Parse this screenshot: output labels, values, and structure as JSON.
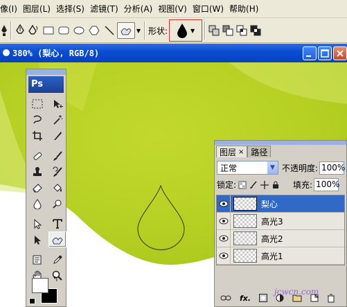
{
  "menu": {
    "items": [
      "像(I)",
      "图层(L)",
      "选择(S)",
      "滤镜(T)",
      "分析(A)",
      "视图(V)",
      "窗口(W)",
      "帮助(H)"
    ]
  },
  "options_bar": {
    "shape_label": "形状:",
    "tools": [
      "pen-icon",
      "freeform-pen-icon",
      "rectangle-icon",
      "rounded-rectangle-icon",
      "ellipse-icon",
      "polygon-icon",
      "line-icon",
      "custom-shape-icon"
    ],
    "shape_selected": "raindrop-shape",
    "combine_modes": [
      "add-icon",
      "subtract-icon",
      "intersect-icon",
      "exclude-icon"
    ]
  },
  "document": {
    "title": "380% (梨心, RGB/8)"
  },
  "toolbox": {
    "logo": "Ps",
    "tools": [
      "marquee-icon",
      "move-icon",
      "lasso-icon",
      "magic-wand-icon",
      "crop-icon",
      "slice-icon",
      "healing-brush-icon",
      "brush-icon",
      "clone-stamp-icon",
      "history-brush-icon",
      "eraser-icon",
      "paint-bucket-icon",
      "blur-icon",
      "dodge-icon",
      "path-selection-icon",
      "type-icon",
      "direct-selection-icon",
      "custom-shape-icon",
      "notes-icon",
      "eyedropper-icon",
      "hand-icon",
      "zoom-icon"
    ],
    "selected_tool": "custom-shape-icon",
    "foreground_color": "#ffffff",
    "background_color": "#000000"
  },
  "layers_panel": {
    "tabs": [
      "图层",
      "路径"
    ],
    "blend_mode": "正常",
    "opacity_label": "不透明度:",
    "opacity": "100%",
    "lock_label": "锁定:",
    "fill_label": "填充:",
    "fill": "100%",
    "layers": [
      {
        "name": "梨心",
        "selected": true
      },
      {
        "name": "高光3",
        "selected": false
      },
      {
        "name": "高光2",
        "selected": false
      },
      {
        "name": "高光1",
        "selected": false
      }
    ],
    "footer_labels": [
      "fx."
    ]
  },
  "watermark": "jcwcn.com",
  "colors": {
    "canvas_green": "#b8d32a",
    "title_blue": "#0a4ed2",
    "layer_selected": "#3169c6"
  }
}
